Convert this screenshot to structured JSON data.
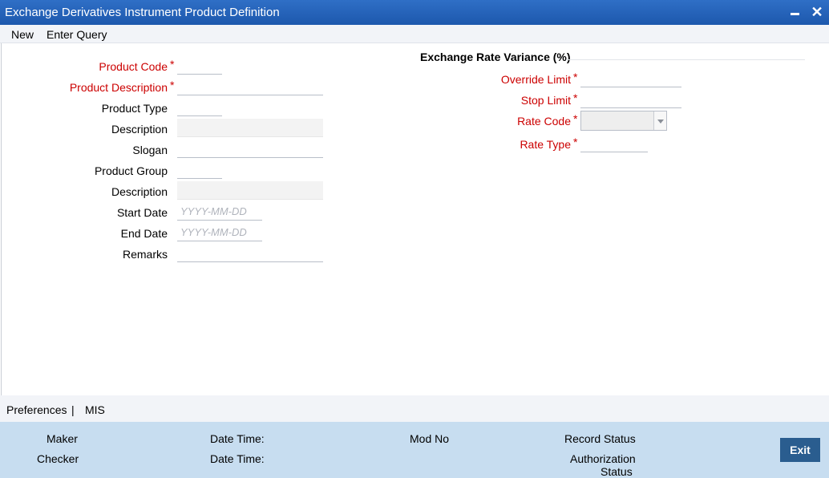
{
  "window": {
    "title": "Exchange Derivatives Instrument Product Definition",
    "minimize_icon": "minimize-icon",
    "close_icon": "close-icon",
    "close_glyph": "✕"
  },
  "menu": {
    "new_label": "New",
    "enter_query_label": "Enter Query"
  },
  "form": {
    "product_code": {
      "label": "Product Code",
      "value": ""
    },
    "product_description": {
      "label": "Product Description",
      "value": ""
    },
    "product_type": {
      "label": "Product Type",
      "value": ""
    },
    "description1": {
      "label": "Description",
      "value": ""
    },
    "slogan": {
      "label": "Slogan",
      "value": ""
    },
    "product_group": {
      "label": "Product Group",
      "value": ""
    },
    "description2": {
      "label": "Description",
      "value": ""
    },
    "start_date": {
      "label": "Start Date",
      "placeholder": "YYYY-MM-DD",
      "value": ""
    },
    "end_date": {
      "label": "End Date",
      "placeholder": "YYYY-MM-DD",
      "value": ""
    },
    "remarks": {
      "label": "Remarks",
      "value": ""
    },
    "required_marker": "*"
  },
  "variance": {
    "title": "Exchange Rate Variance (%)",
    "override_limit": {
      "label": "Override Limit",
      "value": ""
    },
    "stop_limit": {
      "label": "Stop Limit",
      "value": ""
    },
    "rate_code": {
      "label": "Rate Code",
      "value": ""
    },
    "rate_type": {
      "label": "Rate Type",
      "value": ""
    }
  },
  "tabs": {
    "preferences": "Preferences",
    "separator": "|",
    "mis": "MIS"
  },
  "footer": {
    "maker": "Maker",
    "checker": "Checker",
    "date_time_1": "Date Time:",
    "date_time_2": "Date Time:",
    "mod_no": "Mod No",
    "record_status": "Record Status",
    "authorization_status_line1": "Authorization",
    "authorization_status_line2": "Status",
    "exit_label": "Exit"
  },
  "colors": {
    "title_bar": "#1d58ad",
    "required": "#cc0000",
    "footer_bg": "#c7ddf0",
    "exit_button": "#2a5d8f"
  }
}
